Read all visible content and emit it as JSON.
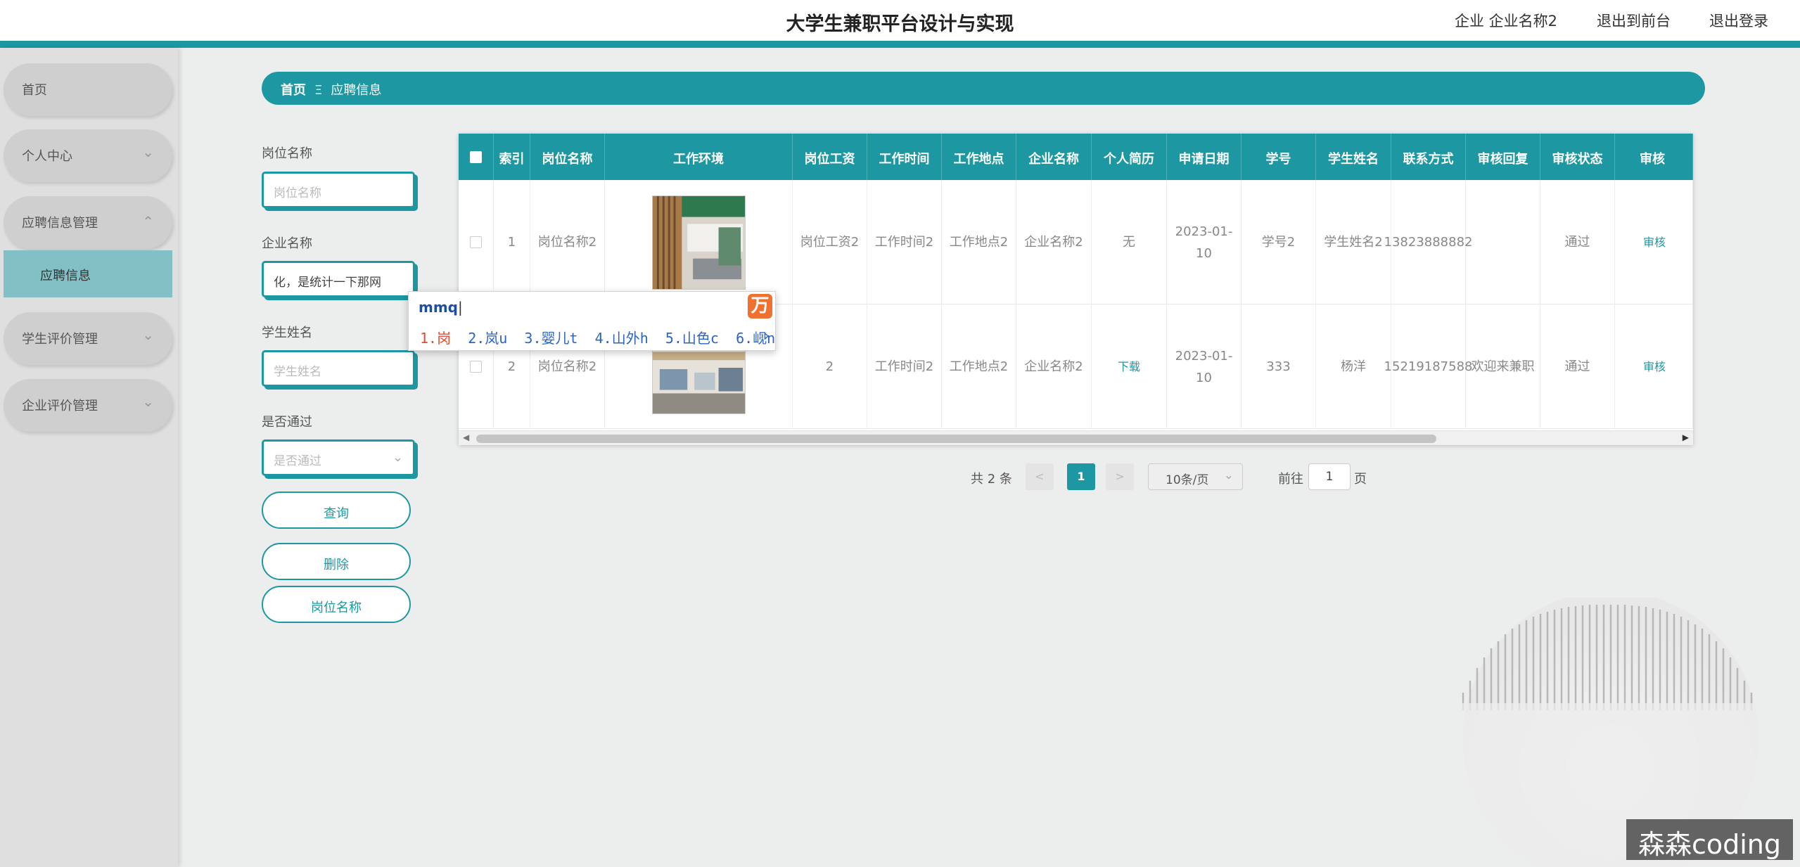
{
  "header": {
    "title": "大学生兼职平台设计与实现",
    "company": "企业 企业名称2",
    "back_front": "退出到前台",
    "logout": "退出登录"
  },
  "sidebar": {
    "items": [
      {
        "label": "首页"
      },
      {
        "label": "个人中心"
      },
      {
        "label": "应聘信息管理"
      },
      {
        "label": "应聘信息"
      },
      {
        "label": "学生评价管理"
      },
      {
        "label": "企业评价管理"
      }
    ]
  },
  "breadcrumb": {
    "home": "首页",
    "sep": "Ξ",
    "current": "应聘信息"
  },
  "search": {
    "job_label": "岗位名称",
    "job_placeholder": "岗位名称",
    "company_label": "企业名称",
    "company_value": "化，是统计一下那网",
    "student_label": "学生姓名",
    "student_placeholder": "学生姓名",
    "pass_label": "是否通过",
    "pass_placeholder": "是否通过",
    "query_btn": "查询",
    "delete_btn": "删除",
    "extra_btn": "岗位名称"
  },
  "ime": {
    "composition": "mmq",
    "candidates": [
      "1.岗",
      "2.岚u",
      "3.婴儿t",
      "4.山外h",
      "5.山色c",
      "6.岘n"
    ],
    "logo": "万"
  },
  "table": {
    "columns": [
      "索引",
      "岗位名称",
      "工作环境",
      "岗位工资",
      "工作时间",
      "工作地点",
      "企业名称",
      "个人简历",
      "申请日期",
      "学号",
      "学生姓名",
      "联系方式",
      "审核回复",
      "审核状态",
      "审核"
    ],
    "rows": [
      {
        "index": "1",
        "job": "岗位名称2",
        "salary": "岗位工资2",
        "time": "工作时间2",
        "place": "工作地点2",
        "company": "企业名称2",
        "resume": "无",
        "date": "2023-01-10",
        "sid": "学号2",
        "sname": "学生姓名2",
        "contact": "13823888882",
        "reply": "",
        "status": "通过",
        "action": "审核"
      },
      {
        "index": "2",
        "job": "岗位名称2",
        "salary": "2",
        "time": "工作时间2",
        "place": "工作地点2",
        "company": "企业名称2",
        "resume": "下载",
        "date": "2023-01-10",
        "sid": "333",
        "sname": "杨洋",
        "contact": "15219187588",
        "reply": "欢迎来兼职",
        "status": "通过",
        "action": "审核"
      }
    ]
  },
  "pagination": {
    "total": "共 2 条",
    "prev": "<",
    "current": "1",
    "next": ">",
    "page_size": "10条/页",
    "goto_label": "前往",
    "goto_value": "1",
    "page_unit": "页"
  },
  "watermark": "森森coding",
  "colors": {
    "accent": "#1d98a2",
    "sidebar_active": "#82c0c6",
    "ime_logo": "#f07030"
  }
}
